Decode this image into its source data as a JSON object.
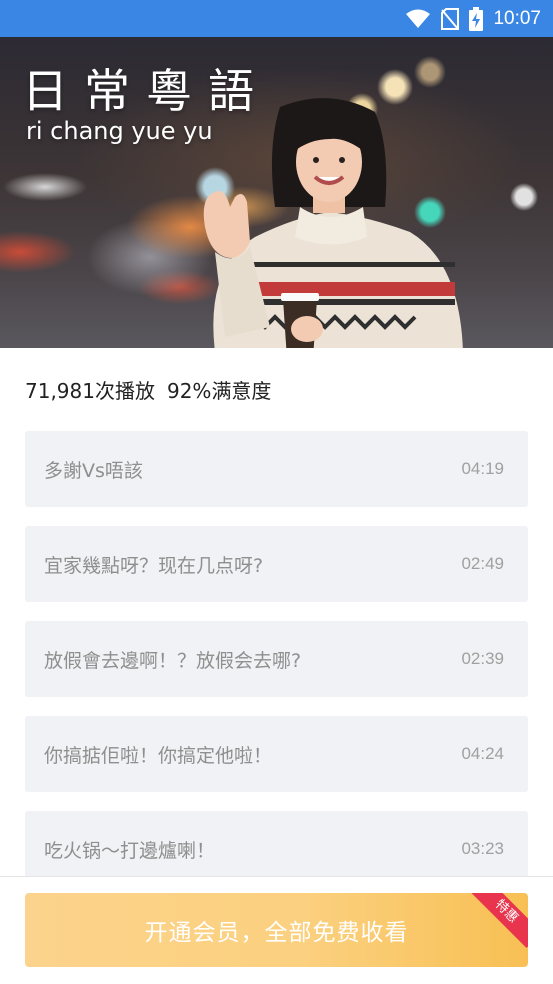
{
  "status_bar": {
    "time": "10:07",
    "icons": [
      "wifi-icon",
      "no-sim-icon",
      "battery-charging-icon"
    ],
    "color": "#3a86e4"
  },
  "hero": {
    "title": "日常粵語",
    "subtitle": "ri chang yue yu"
  },
  "stats": {
    "plays": "71,981次播放",
    "satisfaction": "92%满意度"
  },
  "lessons": [
    {
      "title": "多謝Vs唔該",
      "duration": "04:19"
    },
    {
      "title": "宜家幾點呀？现在几点呀?",
      "duration": "02:49"
    },
    {
      "title": "放假會去邊啊！？放假会去哪?",
      "duration": "02:39"
    },
    {
      "title": "你搞掂佢啦！你搞定他啦！",
      "duration": "04:24"
    },
    {
      "title": "吃火锅～打邊爐喇！",
      "duration": "03:23"
    }
  ],
  "vip": {
    "label": "开通会员，全部免费收看",
    "badge": "特惠",
    "colors": {
      "start": "#fcd38c",
      "end": "#f8c054",
      "badge": "#e8344c"
    }
  }
}
